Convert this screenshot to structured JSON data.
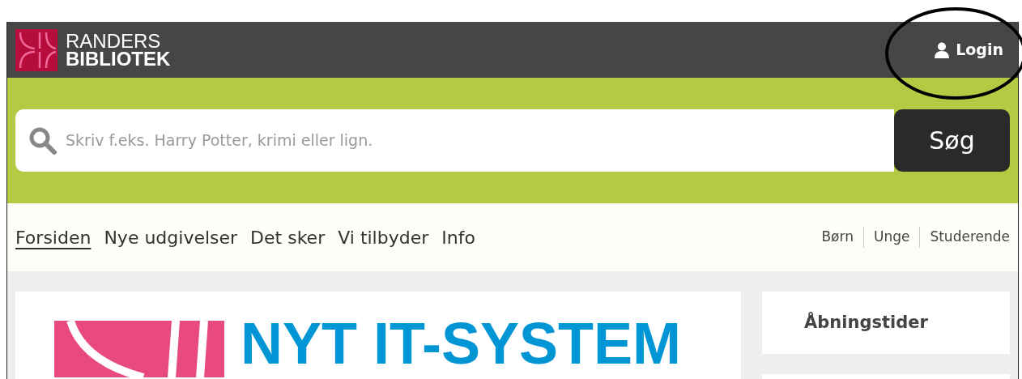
{
  "header": {
    "logo_line_1": "RANDERS",
    "logo_line_2": "BIBLIOTEK",
    "login": "Login"
  },
  "search": {
    "placeholder": "Skriv f.eks. Harry Potter, krimi eller lign.",
    "button": "Søg"
  },
  "nav": {
    "items": [
      {
        "label": "Forsiden",
        "selected": true
      },
      {
        "label": "Nye udgivelser",
        "selected": false
      },
      {
        "label": "Det sker",
        "selected": false
      },
      {
        "label": "Vi tilbyder",
        "selected": false
      },
      {
        "label": "Info",
        "selected": false
      }
    ],
    "audience_links": [
      "Børn",
      "Unge",
      "Studerende"
    ]
  },
  "banner": {
    "headline": "NYT IT-SYSTEM"
  },
  "sidebar": {
    "cards": [
      "Åbningstider"
    ]
  }
}
